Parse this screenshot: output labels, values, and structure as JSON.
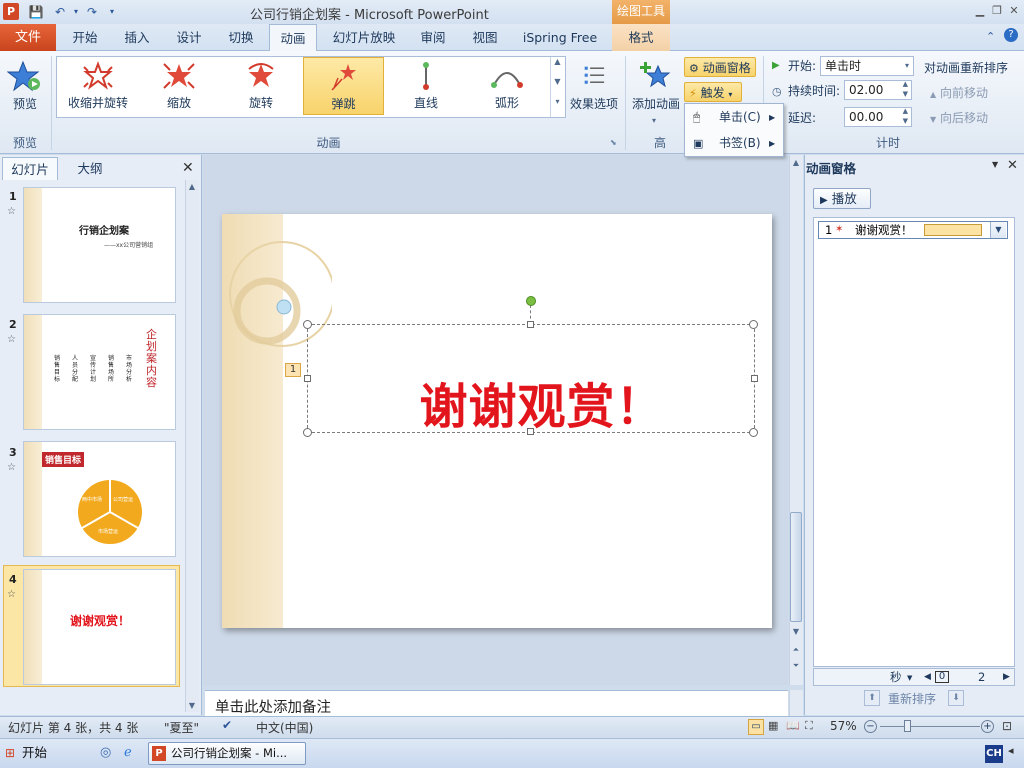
{
  "window": {
    "title": "公司行销企划案 - Microsoft PowerPoint",
    "contextual_tab_group": "绘图工具",
    "app_icon_letter": "P"
  },
  "tabs": [
    "文件",
    "开始",
    "插入",
    "设计",
    "切换",
    "动画",
    "幻灯片放映",
    "审阅",
    "视图",
    "iSpring Free",
    "格式"
  ],
  "active_tab": "动画",
  "ribbon": {
    "preview": {
      "label": "预览",
      "group": "预览"
    },
    "animation_group": "动画",
    "animations": [
      "收缩并旋转",
      "缩放",
      "旋转",
      "弹跳",
      "直线",
      "弧形"
    ],
    "selected_animation": "弹跳",
    "effect_options": "效果选项",
    "add_animation": "添加动画",
    "advanced_group": "高",
    "animation_pane_btn": "动画窗格",
    "trigger_btn": "触发",
    "timing": {
      "group": "计时",
      "start_label": "开始:",
      "start_value": "单击时",
      "duration_label": "持续时间:",
      "duration_value": "02.00",
      "delay_label": "延迟:",
      "delay_value": "00.00",
      "reorder_title": "对动画重新排序",
      "move_earlier": "向前移动",
      "move_later": "向后移动"
    }
  },
  "trigger_menu": {
    "items": [
      "单击(C)",
      "书签(B)"
    ]
  },
  "left_panel": {
    "tabs": [
      "幻灯片",
      "大纲"
    ],
    "slides": [
      {
        "num": "1",
        "title": "行销企划案",
        "subtitle": "——xx公司营销组"
      },
      {
        "num": "2",
        "title": "企划案内容",
        "columns": [
          "销售目标",
          "人员分配",
          "宣传计划",
          "销售场所",
          "市场分析"
        ]
      },
      {
        "num": "3",
        "title": "销售目标",
        "segments": [
          "两中市场",
          "公司营运",
          "市场营运"
        ]
      },
      {
        "num": "4",
        "title": "谢谢观赏！"
      }
    ],
    "selected_slide": 4
  },
  "slide": {
    "text": "谢谢观赏！",
    "anim_tag": "1"
  },
  "notes_placeholder": "单击此处添加备注",
  "anim_pane": {
    "title": "动画窗格",
    "play": "播放",
    "items": [
      {
        "order": "1",
        "name": "谢谢观赏！"
      }
    ],
    "footer_unit": "秒",
    "footer_scale": [
      "0",
      "2"
    ],
    "reorder": "重新排序"
  },
  "statusbar": {
    "slide_info": "幻灯片 第 4 张，共 4 张",
    "theme": "\"夏至\"",
    "language": "中文(中国)",
    "zoom": "57%"
  },
  "taskbar": {
    "start": "开始",
    "app_window": "公司行销企划案 - Mi...",
    "ime": "CH"
  },
  "colors": {
    "file_tab": "#d24726",
    "slide_text": "#e3151c",
    "highlight": "#f8d36b"
  }
}
